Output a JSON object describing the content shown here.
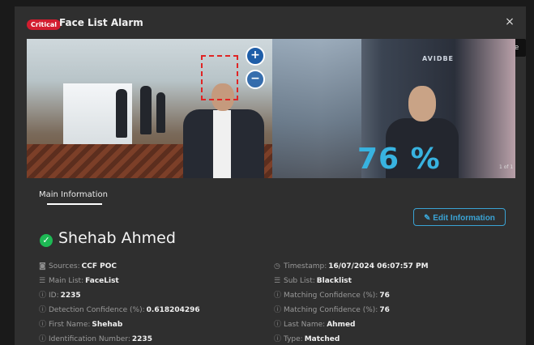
{
  "header": {
    "badge": "Critical",
    "title": "Face List Alarm",
    "close_glyph": "×",
    "close_tooltip": "Close"
  },
  "media": {
    "zoom_in_glyph": "+",
    "zoom_out_glyph": "−",
    "confidence_overlay": "76 %",
    "page_indicator": "1 of 1",
    "sign_text": "AVIDBE"
  },
  "tabs": {
    "main_info": "Main Information"
  },
  "actions": {
    "edit_label": "Edit Information",
    "edit_icon": "pencil-icon"
  },
  "person": {
    "status_icon": "check-circle-icon",
    "name": "Shehab Ahmed"
  },
  "colors": {
    "critical": "#d21d2f",
    "accent": "#3aa3d4",
    "confidence_overlay": "#38b3e0",
    "detection_box": "#e02424",
    "status_ok": "#1db954"
  },
  "info": {
    "left": [
      {
        "icon": "camera-icon",
        "label": "Sources:",
        "value": "CCF POC"
      },
      {
        "icon": "list-icon",
        "label": "Main List:",
        "value": "FaceList"
      },
      {
        "icon": "info-icon",
        "label": "ID:",
        "value": "2235"
      },
      {
        "icon": "info-icon",
        "label": "Detection Confidence (%):",
        "value": "0.618204296"
      },
      {
        "icon": "info-icon",
        "label": "First Name:",
        "value": "Shehab"
      },
      {
        "icon": "info-icon",
        "label": "Identification Number:",
        "value": "2235"
      }
    ],
    "right": [
      {
        "icon": "clock-icon",
        "label": "Timestamp:",
        "value": "16/07/2024 06:07:57 PM"
      },
      {
        "icon": "list-icon",
        "label": "Sub List:",
        "value": "Blacklist"
      },
      {
        "icon": "info-icon",
        "label": "Matching Confidence (%):",
        "value": "76"
      },
      {
        "icon": "info-icon",
        "label": "Matching Confidence (%):",
        "value": "76"
      },
      {
        "icon": "info-icon",
        "label": "Last Name:",
        "value": "Ahmed"
      },
      {
        "icon": "info-icon",
        "label": "Type:",
        "value": "Matched"
      }
    ]
  }
}
